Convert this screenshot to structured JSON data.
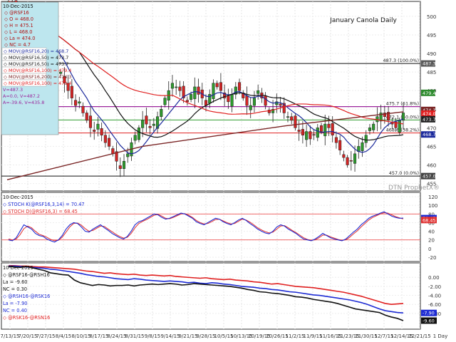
{
  "title": "January Canola Daily",
  "watermark": "DTN ProphetX®",
  "colors": {
    "up": "#2e9b2e",
    "down": "#d42424",
    "ma20": "#1c2a9c",
    "ma50": "#111111",
    "ma100": "#e02020",
    "ma200": "#7a2525",
    "fib": "#9b249b",
    "stochK": "#1d2bd4",
    "stochD": "#e03030",
    "spread1": "#111111",
    "spread2": "#1d2bd4",
    "spread3": "#e02020",
    "infoBg": "#bde6ee",
    "axisText": "#333333"
  },
  "info": {
    "date": "10-Dec-2015",
    "lines": [
      "@RSF16",
      "O = 468.0",
      "H = 475.1",
      "L = 468.0",
      "La = 474.0",
      "NC = 4.7"
    ],
    "mas": [
      {
        "label": "MOV(@RSF16,20) = 468.7",
        "color": "#1c2a9c"
      },
      {
        "label": "MOV(@RSF16,50) = 473.7",
        "color": "#111111"
      },
      {
        "label": "MOV(@RSF16,50) = 473.7",
        "color": "#111111"
      },
      {
        "label": "MOV(@RSF16,100) = 479.4",
        "color": "#e02020"
      },
      {
        "label": "MOV(@RSF16,200) = 474.3",
        "color": "#7a2525"
      },
      {
        "label": "MOV(@RSF16,100) = 479.4",
        "color": "#e02020"
      }
    ],
    "extra": [
      "V=487.3",
      "A=0.0, V=487.2",
      "A=-39.6, V=435.8"
    ]
  },
  "stoch_info": {
    "date": "10-Dec-2015",
    "k": "STOCH K(@RSF16,3,14) = 70.47",
    "d": "STOCH D(@RSF16,3) = 68.45"
  },
  "spread_info": {
    "date": "10-Dec-2015",
    "lines": [
      "@RSF16-@RSH16",
      "La = -9.60",
      "NC = 0.30",
      "@RSH16-@RSK16",
      "La = -7.90",
      "NC = 0.40",
      "@RSK16-@RSN16"
    ]
  },
  "fib_labels": [
    {
      "text": "487.3 (100.0%)",
      "value": 487.3
    },
    {
      "text": "475.7 (61.8%)",
      "value": 475.7
    },
    {
      "text": "472.1 (50.0%)",
      "value": 472.1
    },
    {
      "text": "468.6 (38.2%)",
      "value": 468.6
    },
    {
      "text": "457.0 (0.0%)",
      "value": 457.0
    }
  ],
  "price_badges": [
    {
      "text": "487.3",
      "value": 487.3,
      "bg": "#5a5a5a"
    },
    {
      "text": "479.4",
      "value": 479.4,
      "bg": "#2e8b2e"
    },
    {
      "text": "474.3",
      "value": 474.8,
      "bg": "#7a2525"
    },
    {
      "text": "474.0",
      "value": 473.8,
      "bg": "#e02020"
    },
    {
      "text": "473.7",
      "value": 472.3,
      "bg": "#222222"
    },
    {
      "text": "468.7",
      "value": 468.2,
      "bg": "#1c2a9c"
    },
    {
      "text": "457.0",
      "value": 457.0,
      "bg": "#444444"
    }
  ],
  "stoch_badges": [
    {
      "text": "70.47",
      "value": 70.47,
      "bg": "#1d2bd4"
    },
    {
      "text": "68.45",
      "value": 66,
      "bg": "#e03030"
    }
  ],
  "spread_badges": [
    {
      "text": "-7.90",
      "value": -7.9,
      "bg": "#1d2bd4"
    },
    {
      "text": "-9.60",
      "value": -9.6,
      "bg": "#111111"
    }
  ],
  "x_tick_labels": [
    "7/13/15",
    "7/20/15",
    "7/27/15",
    "8/4/15",
    "8/10/15",
    "8/17/15",
    "8/24/15",
    "8/31/15",
    "9/8/15",
    "9/14/15",
    "9/21/15",
    "9/28/15",
    "10/5/15",
    "10/13/15",
    "10/19/15",
    "10/26/15",
    "11/2/15",
    "11/9/15",
    "11/16/15",
    "11/23/15",
    "11/30/15",
    "12/7/15",
    "12/14/15",
    "12/21/15"
  ],
  "x_footer": "1 Day",
  "chart_data": {
    "type": "candlestick",
    "title": "January Canola Daily",
    "price": {
      "ylim": [
        453,
        504
      ],
      "yticks": [
        455,
        460,
        465,
        470,
        475,
        480,
        485,
        490,
        495,
        500
      ],
      "fib_levels": [
        487.3,
        475.7,
        472.1,
        468.6,
        457.0
      ],
      "closes": [
        504,
        503,
        501,
        499,
        497,
        496,
        498,
        494,
        495,
        493,
        491,
        488,
        486,
        484,
        485,
        482,
        480,
        478,
        476,
        477,
        474,
        472,
        470,
        469,
        471,
        468,
        466,
        465,
        463,
        461,
        459,
        461,
        463,
        466,
        468,
        470,
        472,
        471,
        470,
        471,
        473,
        475,
        478,
        480,
        482,
        481,
        480,
        478,
        477,
        479,
        481,
        479,
        478,
        476,
        479,
        482,
        481,
        480,
        478,
        477,
        479,
        481,
        480,
        478,
        476,
        476,
        478,
        480,
        478,
        476,
        474,
        475,
        477,
        476,
        474,
        473,
        472,
        470,
        469,
        468,
        469,
        467,
        468,
        470,
        469,
        471,
        470,
        468,
        466,
        464,
        462,
        460,
        461,
        463,
        465,
        466,
        468,
        470,
        471,
        473,
        474,
        473,
        472,
        471,
        470,
        472,
        474
      ]
    },
    "stochastic": {
      "ylim": [
        -30,
        130
      ],
      "yticks": [
        -20,
        0,
        20,
        40,
        60,
        80,
        100,
        120
      ],
      "overbought": 80,
      "oversold": 20,
      "k": [
        20,
        18,
        25,
        40,
        55,
        50,
        45,
        35,
        30,
        28,
        22,
        18,
        15,
        20,
        30,
        45,
        55,
        60,
        58,
        50,
        40,
        38,
        45,
        50,
        55,
        48,
        42,
        35,
        30,
        25,
        22,
        28,
        40,
        55,
        62,
        65,
        70,
        75,
        80,
        78,
        72,
        68,
        70,
        74,
        78,
        82,
        80,
        75,
        70,
        62,
        58,
        55,
        60,
        65,
        70,
        68,
        62,
        58,
        55,
        60,
        66,
        70,
        65,
        58,
        52,
        45,
        40,
        36,
        34,
        40,
        50,
        55,
        52,
        45,
        40,
        35,
        28,
        22,
        20,
        18,
        22,
        28,
        35,
        30,
        25,
        22,
        20,
        18,
        22,
        30,
        38,
        45,
        55,
        62,
        70,
        75,
        78,
        82,
        85,
        80,
        75,
        72,
        70,
        70.47
      ],
      "d": [
        22,
        20,
        22,
        32,
        46,
        52,
        48,
        40,
        33,
        30,
        26,
        21,
        18,
        19,
        26,
        38,
        50,
        58,
        59,
        54,
        46,
        40,
        42,
        47,
        52,
        51,
        45,
        39,
        33,
        28,
        24,
        26,
        35,
        48,
        58,
        63,
        67,
        72,
        77,
        79,
        75,
        70,
        69,
        72,
        76,
        80,
        81,
        77,
        72,
        65,
        60,
        57,
        58,
        62,
        67,
        68,
        64,
        60,
        57,
        58,
        63,
        68,
        66,
        61,
        55,
        48,
        43,
        39,
        36,
        38,
        45,
        52,
        53,
        48,
        42,
        37,
        31,
        25,
        21,
        19,
        20,
        25,
        31,
        31,
        27,
        24,
        21,
        19,
        20,
        26,
        34,
        41,
        50,
        58,
        66,
        72,
        76,
        80,
        83,
        82,
        78,
        74,
        71,
        68.45
      ]
    },
    "spread": {
      "ylim": [
        -11.5,
        3.2
      ],
      "yticks": [
        0,
        -2,
        -4,
        -6,
        -8
      ],
      "series": [
        {
          "name": "@RSF16-@RSH16",
          "values": [
            2.4,
            2.3,
            2.2,
            2.4,
            2.1,
            1.8,
            1.5,
            1.0,
            0.8,
            0.6,
            0.5,
            -0.6,
            -1.2,
            -1.5,
            -1.8,
            -1.6,
            -1.7,
            -1.9,
            -1.8,
            -1.8,
            -1.7,
            -1.9,
            -1.7,
            -1.6,
            -1.5,
            -1.6,
            -1.5,
            -1.4,
            -1.5,
            -1.7,
            -1.6,
            -1.4,
            -1.5,
            -1.6,
            -1.7,
            -1.8,
            -1.9,
            -2.0,
            -2.2,
            -2.4,
            -2.7,
            -2.9,
            -3.2,
            -3.3,
            -3.5,
            -3.6,
            -3.8,
            -4.0,
            -4.3,
            -4.4,
            -4.6,
            -4.9,
            -5.1,
            -5.3,
            -5.5,
            -5.8,
            -6.2,
            -6.6,
            -7.0,
            -7.2,
            -7.4,
            -7.6,
            -7.8,
            -8.4,
            -8.8,
            -9.1,
            -9.6
          ]
        },
        {
          "name": "@RSH16-@RSK16",
          "values": [
            2.5,
            2.5,
            2.4,
            2.3,
            2.2,
            2.1,
            2.0,
            1.8,
            1.7,
            1.5,
            1.3,
            1.1,
            0.9,
            0.6,
            0.4,
            0.2,
            0.1,
            -0.1,
            -0.3,
            -0.4,
            -0.5,
            -0.3,
            -0.4,
            -0.6,
            -0.7,
            -0.8,
            -0.9,
            -0.8,
            -0.9,
            -1.0,
            -1.2,
            -1.1,
            -1.3,
            -1.4,
            -1.2,
            -1.3,
            -1.5,
            -1.6,
            -1.8,
            -2.0,
            -2.1,
            -2.2,
            -2.4,
            -2.5,
            -2.7,
            -2.8,
            -3.0,
            -3.2,
            -3.3,
            -3.5,
            -3.7,
            -3.9,
            -4.0,
            -4.2,
            -4.4,
            -4.6,
            -4.8,
            -5.0,
            -5.3,
            -5.6,
            -6.0,
            -6.5,
            -7.0,
            -7.4,
            -7.6,
            -7.8,
            -7.9
          ]
        },
        {
          "name": "@RSK16-@RSN16",
          "values": [
            2.6,
            2.6,
            2.5,
            2.5,
            2.4,
            2.3,
            2.3,
            2.2,
            2.1,
            2.0,
            1.9,
            1.8,
            1.6,
            1.4,
            1.3,
            1.1,
            0.9,
            1.0,
            0.8,
            0.7,
            0.6,
            0.7,
            0.5,
            0.4,
            0.5,
            0.4,
            0.3,
            0.4,
            0.2,
            0.1,
            0.0,
            -0.1,
            -0.2,
            -0.1,
            -0.3,
            -0.4,
            -0.5,
            -0.4,
            -0.6,
            -0.7,
            -0.8,
            -1.0,
            -1.1,
            -1.3,
            -1.5,
            -1.4,
            -1.6,
            -1.8,
            -2.0,
            -2.1,
            -2.2,
            -2.3,
            -2.5,
            -2.7,
            -2.9,
            -3.1,
            -3.3,
            -3.6,
            -3.9,
            -4.2,
            -4.6,
            -5.0,
            -5.4,
            -5.8,
            -6.0,
            -5.9,
            -5.8
          ]
        }
      ]
    }
  }
}
